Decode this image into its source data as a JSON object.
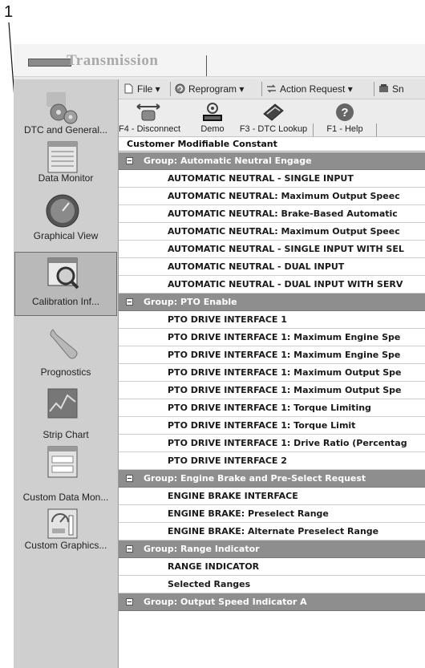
{
  "callout": {
    "number": "1"
  },
  "app": {
    "title": "Transmission"
  },
  "sidebar": {
    "items": [
      {
        "label": "DTC and General...",
        "icon": "gears-icon"
      },
      {
        "label": "Data Monitor",
        "icon": "data-monitor-icon"
      },
      {
        "label": "Graphical View",
        "icon": "gauge-icon"
      },
      {
        "label": "Calibration Inf...",
        "icon": "calibration-magnifier-icon",
        "selected": true
      },
      {
        "label": "Prognostics",
        "icon": "wrench-icon"
      },
      {
        "label": "Strip Chart",
        "icon": "strip-chart-icon"
      },
      {
        "label": "Custom Data Mon...",
        "icon": "custom-data-monitor-icon"
      },
      {
        "label": "Custom Graphics...",
        "icon": "custom-graphics-icon"
      }
    ]
  },
  "menubar": {
    "file": "File",
    "reprogram": "Reprogram",
    "action_request": "Action Request",
    "snapshot": "Sn"
  },
  "toolbar": {
    "disconnect": "F4 - Disconnect",
    "demo": "Demo",
    "dtc_lookup": "F3 - DTC Lookup",
    "help": "F1 - Help"
  },
  "grid": {
    "header": "Customer Modifiable Constant",
    "rows": [
      {
        "type": "group",
        "text": "Group: Automatic Neutral Engage"
      },
      {
        "type": "item",
        "text": "AUTOMATIC NEUTRAL - SINGLE INPUT"
      },
      {
        "type": "item",
        "text": "AUTOMATIC NEUTRAL: Maximum Output Speec"
      },
      {
        "type": "item",
        "text": "AUTOMATIC NEUTRAL: Brake-Based Automatic"
      },
      {
        "type": "item",
        "text": "AUTOMATIC NEUTRAL: Maximum Output Speec"
      },
      {
        "type": "item",
        "text": "AUTOMATIC NEUTRAL - SINGLE INPUT WITH SEL"
      },
      {
        "type": "item",
        "text": "AUTOMATIC NEUTRAL - DUAL INPUT"
      },
      {
        "type": "item",
        "text": "AUTOMATIC NEUTRAL - DUAL INPUT WITH SERV"
      },
      {
        "type": "group",
        "text": "Group: PTO Enable"
      },
      {
        "type": "item",
        "text": "PTO DRIVE INTERFACE 1"
      },
      {
        "type": "item",
        "text": "PTO DRIVE INTERFACE 1: Maximum Engine Spe"
      },
      {
        "type": "item",
        "text": "PTO DRIVE INTERFACE 1: Maximum Engine Spe"
      },
      {
        "type": "item",
        "text": "PTO DRIVE INTERFACE 1: Maximum Output Spe"
      },
      {
        "type": "item",
        "text": "PTO DRIVE INTERFACE 1: Maximum Output Spe"
      },
      {
        "type": "item",
        "text": "PTO DRIVE INTERFACE 1: Torque Limiting"
      },
      {
        "type": "item",
        "text": "PTO DRIVE INTERFACE 1: Torque Limit"
      },
      {
        "type": "item",
        "text": "PTO DRIVE INTERFACE 1: Drive Ratio (Percentag"
      },
      {
        "type": "item",
        "text": "PTO DRIVE INTERFACE 2"
      },
      {
        "type": "group",
        "text": "Group: Engine Brake and Pre-Select Request"
      },
      {
        "type": "item",
        "text": "ENGINE BRAKE INTERFACE"
      },
      {
        "type": "item",
        "text": "ENGINE BRAKE: Preselect Range"
      },
      {
        "type": "item",
        "text": "ENGINE BRAKE: Alternate Preselect Range"
      },
      {
        "type": "group",
        "text": "Group: Range Indicator"
      },
      {
        "type": "item",
        "text": "RANGE INDICATOR"
      },
      {
        "type": "item",
        "text": "Selected Ranges"
      },
      {
        "type": "group",
        "text": "Group: Output Speed Indicator A"
      }
    ]
  }
}
